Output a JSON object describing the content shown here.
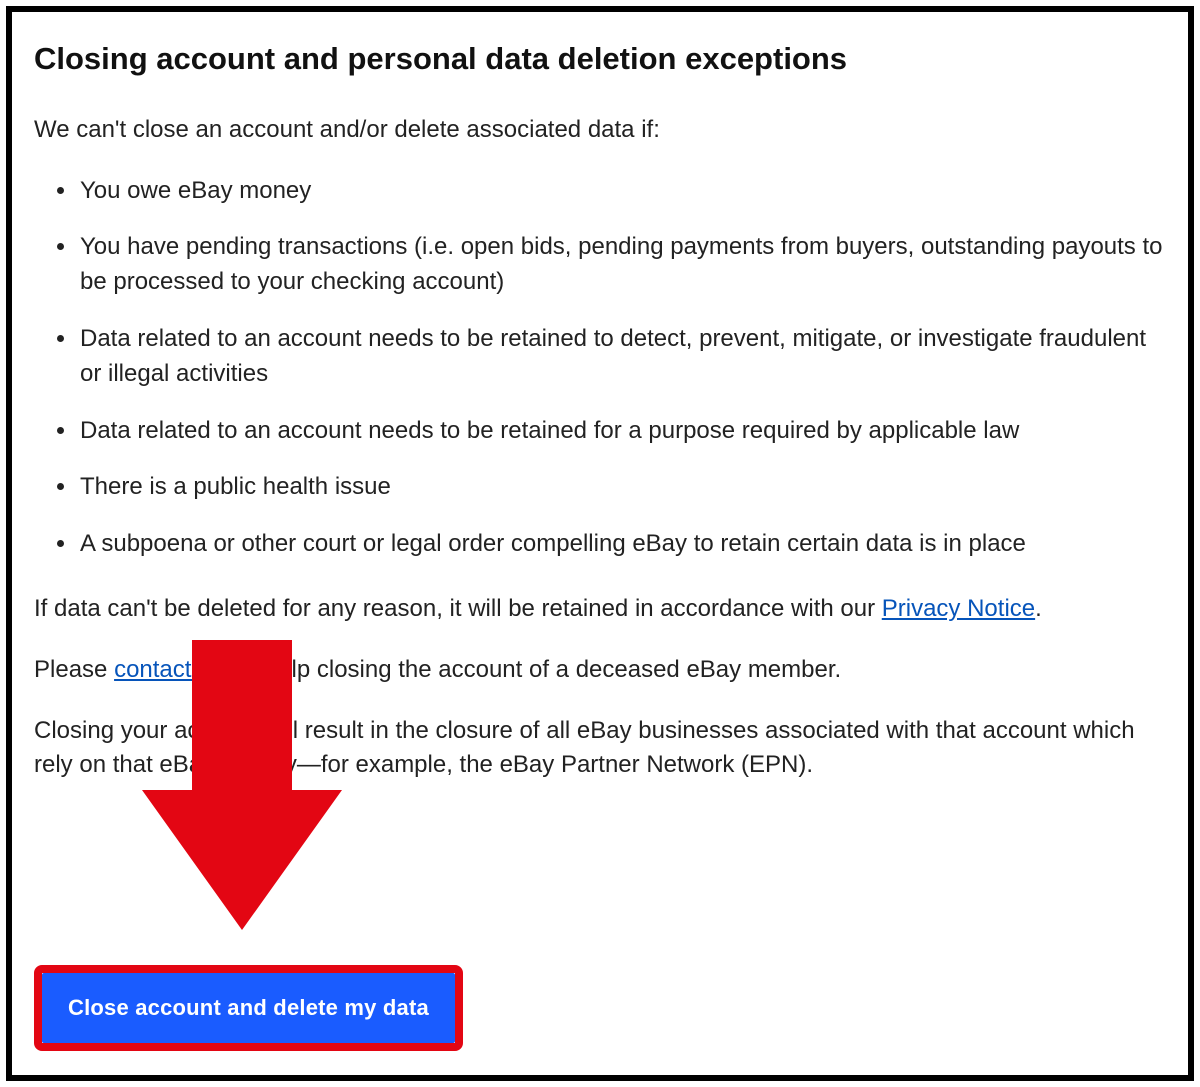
{
  "heading": "Closing account and personal data deletion exceptions",
  "lead": "We can't close an account and/or delete associated data if:",
  "exceptions": [
    "You owe eBay money",
    "You have pending transactions (i.e. open bids, pending payments from buyers, outstanding payouts to be processed to your checking account)",
    "Data related to an account needs to be retained to detect, prevent, mitigate, or investigate fraudulent or illegal activities",
    "Data related to an account needs to be retained for a purpose required by applicable law",
    "There is a public health issue",
    "A subpoena or other court or legal order compelling eBay to retain certain data is in place"
  ],
  "privacy_para": {
    "before": "If data can't be deleted for any reason, it will be retained in accordance with our ",
    "link": "Privacy Notice",
    "after": "."
  },
  "contact_para": {
    "before": "Please ",
    "link": "contact us",
    "after": " for help closing the account of a deceased eBay member."
  },
  "closure_para": "Closing your account will result in the closure of all eBay businesses associated with that account which rely on that eBay identity—for example, the eBay Partner Network (EPN).",
  "cta_label": "Close account and delete my data",
  "colors": {
    "arrow": "#e30613",
    "highlight_border": "#e30613",
    "button_bg": "#1a5cff",
    "link": "#0654ba"
  }
}
